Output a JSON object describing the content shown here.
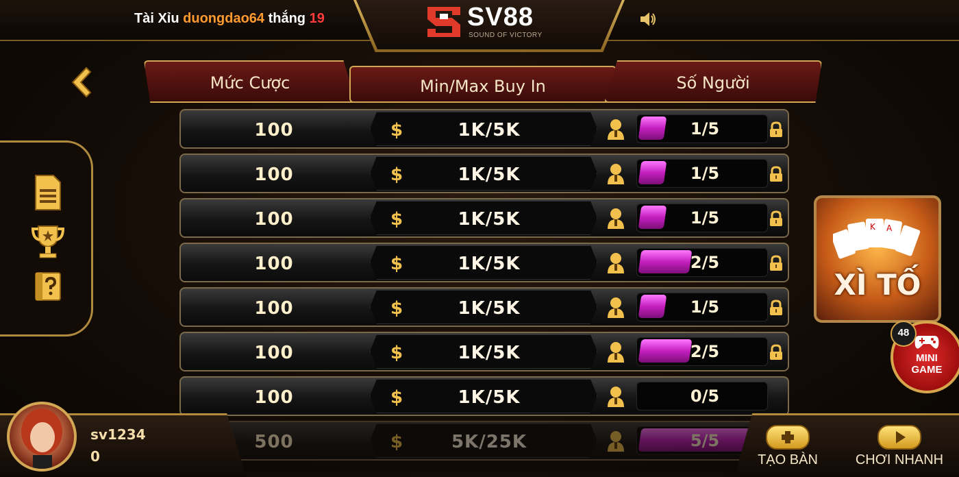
{
  "topbar": {
    "marquee": {
      "game": "Tài Xỉu",
      "user": "duongdao64",
      "verb": "thắng",
      "amount": "19"
    },
    "logo": {
      "brand": "SV88",
      "tagline": "SOUND OF VICTORY"
    }
  },
  "table_header": {
    "bet": "Mức Cược",
    "buyin": "Min/Max Buy In",
    "players": "Số Người"
  },
  "rooms": [
    {
      "bet": "100",
      "buyin": "1K/5K",
      "players": "1/5",
      "fill": 0.2,
      "locked": true
    },
    {
      "bet": "100",
      "buyin": "1K/5K",
      "players": "1/5",
      "fill": 0.2,
      "locked": true
    },
    {
      "bet": "100",
      "buyin": "1K/5K",
      "players": "1/5",
      "fill": 0.2,
      "locked": true
    },
    {
      "bet": "100",
      "buyin": "1K/5K",
      "players": "2/5",
      "fill": 0.4,
      "locked": true
    },
    {
      "bet": "100",
      "buyin": "1K/5K",
      "players": "1/5",
      "fill": 0.2,
      "locked": true
    },
    {
      "bet": "100",
      "buyin": "1K/5K",
      "players": "2/5",
      "fill": 0.4,
      "locked": true
    },
    {
      "bet": "100",
      "buyin": "1K/5K",
      "players": "0/5",
      "fill": 0.0,
      "locked": false
    },
    {
      "bet": "500",
      "buyin": "5K/25K",
      "players": "5/5",
      "fill": 1.0,
      "locked": false
    }
  ],
  "game_banner": {
    "title": "XÌ TỐ"
  },
  "mini_game": {
    "label_line1": "MINI",
    "label_line2": "GAME",
    "badge": "48"
  },
  "user": {
    "name": "sv1234",
    "balance": "0"
  },
  "actions": {
    "create_table": "TẠO BÀN",
    "quick_play": "CHƠI NHANH"
  },
  "colors": {
    "gold": "#d2a855",
    "magenta": "#c41fbf",
    "dark": "#0b0704"
  }
}
